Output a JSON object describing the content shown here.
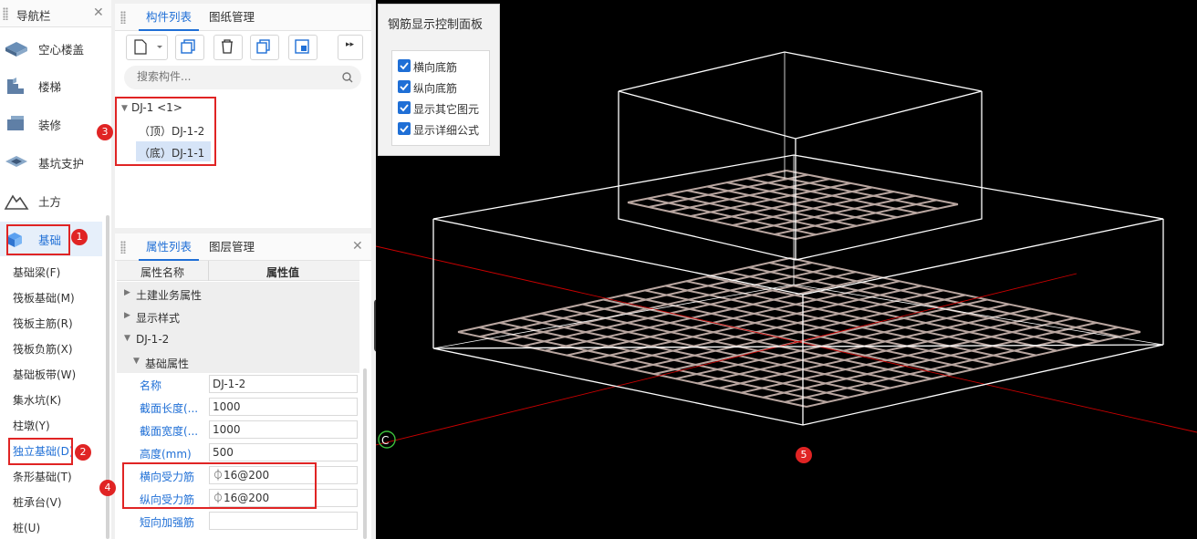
{
  "nav": {
    "title": "导航栏",
    "items": [
      {
        "label": "空心楼盖",
        "icon": "hollow-slab-icon"
      },
      {
        "label": "楼梯",
        "icon": "stairs-icon"
      },
      {
        "label": "装修",
        "icon": "decoration-icon"
      },
      {
        "label": "基坑支护",
        "icon": "pit-support-icon"
      },
      {
        "label": "土方",
        "icon": "earthwork-icon"
      },
      {
        "label": "基础",
        "icon": "foundation-icon"
      }
    ],
    "sub_items": [
      "基础梁(F)",
      "筏板基础(M)",
      "筏板主筋(R)",
      "筏板负筋(X)",
      "基础板带(W)",
      "集水坑(K)",
      "柱墩(Y)",
      "独立基础(D)",
      "条形基础(T)",
      "桩承台(V)",
      "桩(U)"
    ]
  },
  "component_panel": {
    "tabs": [
      "构件列表",
      "图纸管理"
    ],
    "search_placeholder": "搜索构件...",
    "tree": {
      "root": "DJ-1 <1>",
      "children": [
        "（顶）DJ-1-2",
        "（底）DJ-1-1"
      ]
    }
  },
  "property_panel": {
    "tabs": [
      "属性列表",
      "图层管理"
    ],
    "columns": [
      "属性名称",
      "属性值"
    ],
    "groups": [
      "土建业务属性",
      "显示样式",
      "DJ-1-2",
      "基础属性"
    ],
    "rows": [
      {
        "name": "名称",
        "value": "DJ-1-2"
      },
      {
        "name": "截面长度(...",
        "value": "1000"
      },
      {
        "name": "截面宽度(...",
        "value": "1000"
      },
      {
        "name": "高度(mm)",
        "value": "500"
      },
      {
        "name": "横向受力筋",
        "value": "⏀16@200"
      },
      {
        "name": "纵向受力筋",
        "value": "⏀16@200"
      },
      {
        "name": "短向加强筋",
        "value": ""
      }
    ]
  },
  "rebar_panel": {
    "title": "钢筋显示控制面板",
    "options": [
      {
        "label": "横向底筋",
        "checked": true
      },
      {
        "label": "纵向底筋",
        "checked": true
      },
      {
        "label": "显示其它图元",
        "checked": true
      },
      {
        "label": "显示详细公式",
        "checked": true
      }
    ]
  },
  "badges": [
    "1",
    "2",
    "3",
    "4",
    "5"
  ],
  "colors": {
    "accent": "#1f6fd6",
    "highlight": "#e02424",
    "viewport_bg": "#000000",
    "rebar": "#b9a6a0"
  }
}
